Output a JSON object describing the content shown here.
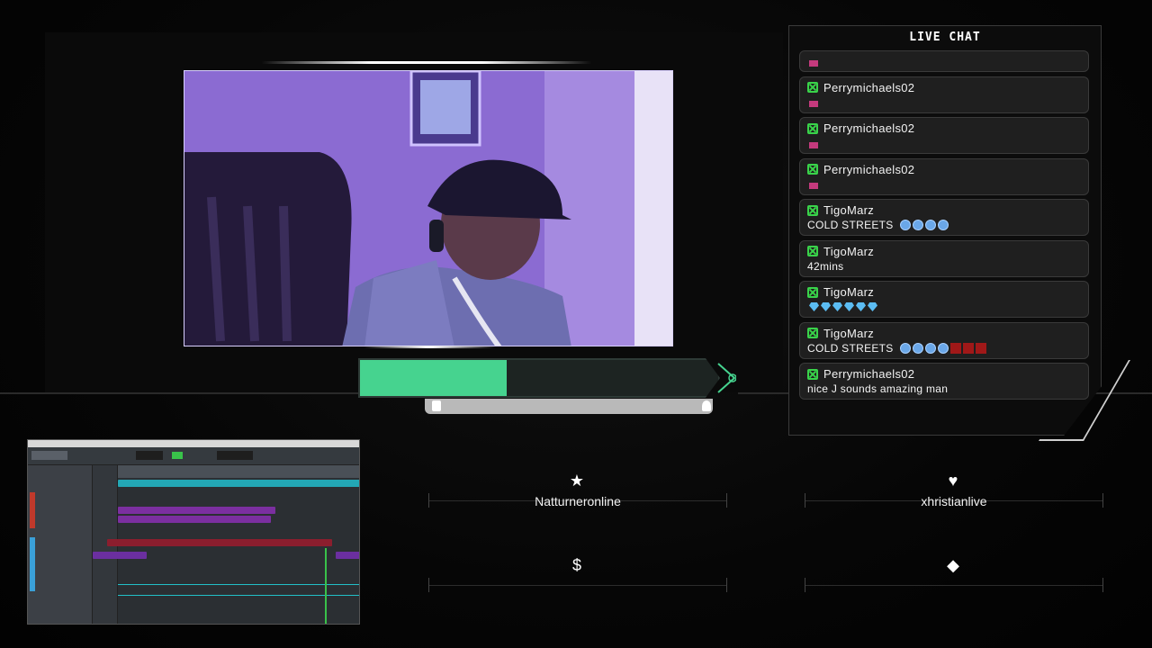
{
  "chat": {
    "title": "LIVE CHAT",
    "messages": [
      {
        "user": "",
        "text": "",
        "partial": true
      },
      {
        "user": "Perrymichaels02",
        "text": ""
      },
      {
        "user": "Perrymichaels02",
        "text": ""
      },
      {
        "user": "Perrymichaels02",
        "text": ""
      },
      {
        "user": "TigoMarz",
        "text": "COLD STREETS"
      },
      {
        "user": "TigoMarz",
        "text": "42mins"
      },
      {
        "user": "TigoMarz",
        "text": ""
      },
      {
        "user": "TigoMarz",
        "text": "COLD STREETS"
      },
      {
        "user": "Perrymichaels02",
        "text": "nice J sounds amazing man"
      }
    ]
  },
  "goal": {
    "progress": 0.41,
    "color": "#46d38f"
  },
  "alerts": {
    "follower": {
      "icon": "star-icon",
      "name": "Natturneronline"
    },
    "subscriber": {
      "icon": "heart-icon",
      "name": "xhristianlive"
    },
    "donation": {
      "icon": "dollar-icon",
      "name": ""
    },
    "bits": {
      "icon": "diamond-icon",
      "name": ""
    }
  },
  "colors": {
    "accent": "#46d38f",
    "platform": "#39d34a"
  }
}
